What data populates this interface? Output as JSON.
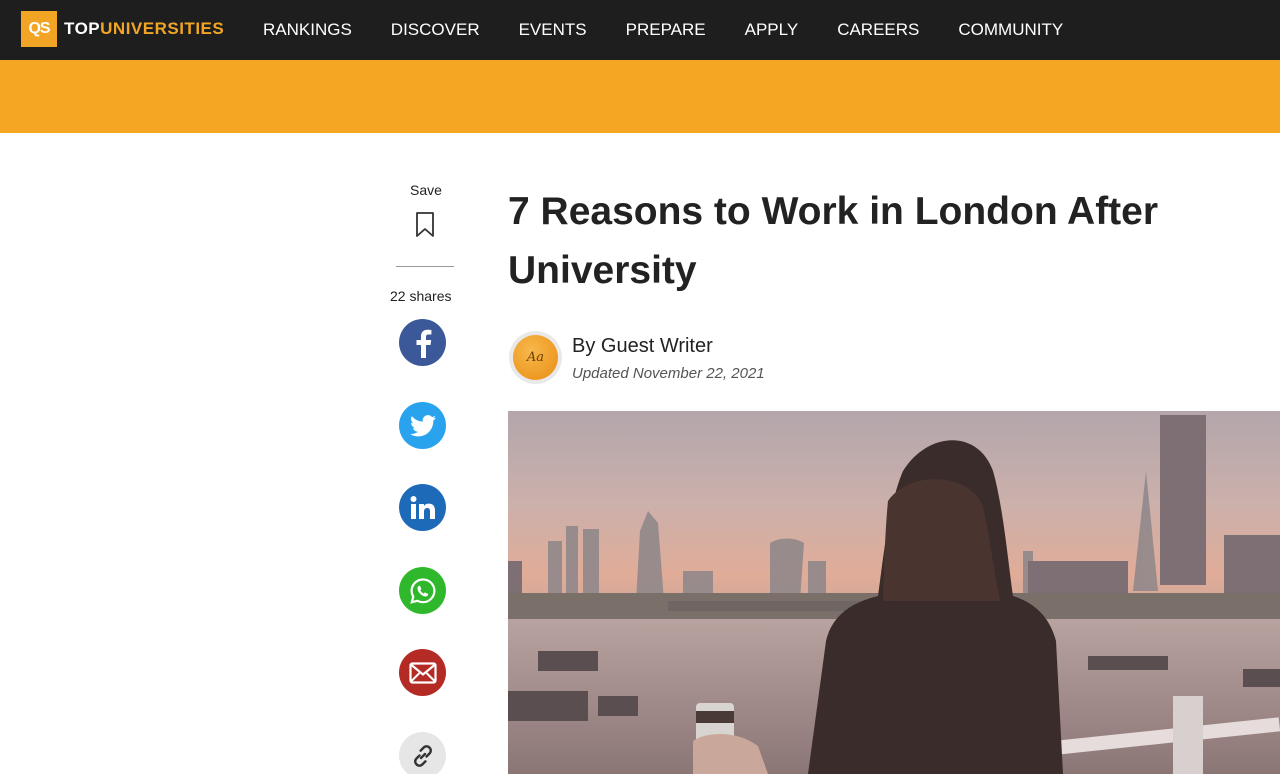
{
  "header": {
    "logo_mark": "QS",
    "logo_top": "TOP",
    "logo_universities": "UNIVERSITIES",
    "nav": [
      "RANKINGS",
      "DISCOVER",
      "EVENTS",
      "PREPARE",
      "APPLY",
      "CAREERS",
      "COMMUNITY"
    ]
  },
  "share": {
    "save_label": "Save",
    "shares_label": "22 shares",
    "icons": [
      "bookmark-icon",
      "facebook-icon",
      "twitter-icon",
      "linkedin-icon",
      "whatsapp-icon",
      "email-icon",
      "link-icon"
    ]
  },
  "article": {
    "title": "7 Reasons to Work in London After University",
    "author": "By Guest Writer",
    "updated": "Updated November 22, 2021",
    "avatar_text": "Aa"
  },
  "colors": {
    "topbar": "#1e1e1e",
    "brand_orange": "#f5a623",
    "facebook": "#3b5998",
    "twitter": "#2aa3ef",
    "linkedin": "#1d6ab9",
    "whatsapp": "#2fb82b",
    "email": "#b42a24",
    "link": "#e6e6e6"
  }
}
